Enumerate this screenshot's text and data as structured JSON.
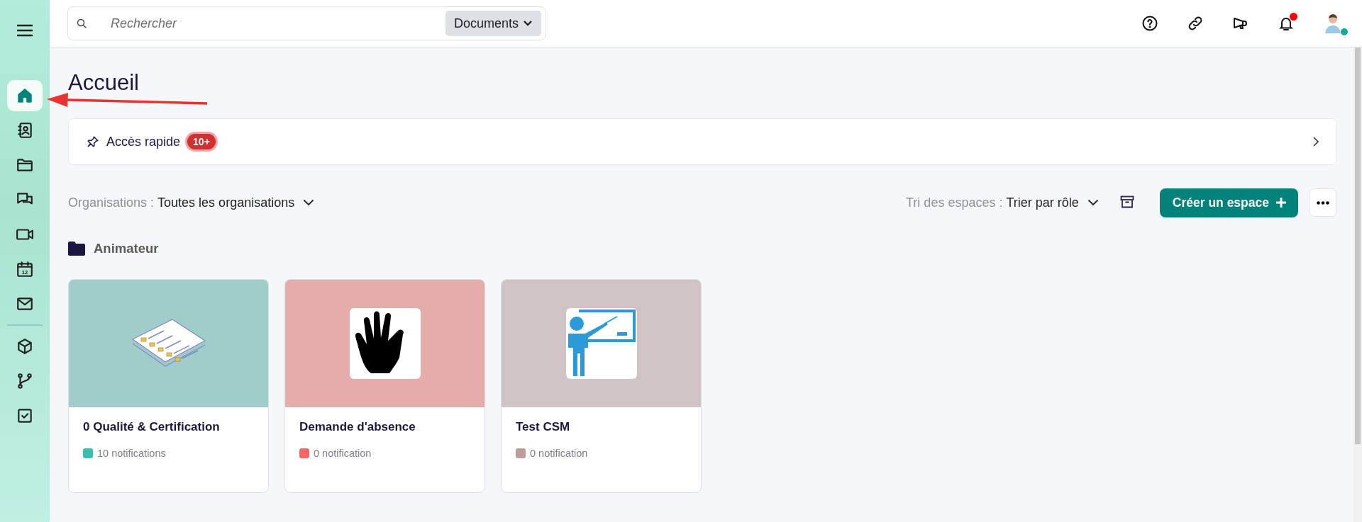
{
  "sidebar": {
    "sections": [
      {
        "items": [
          {
            "selected": true
          },
          {
            "selected": false
          },
          {
            "selected": false
          },
          {
            "selected": false
          },
          {
            "selected": false
          },
          {
            "selected": false,
            "label": "12"
          },
          {
            "selected": false
          }
        ]
      },
      {
        "items": [
          {
            "selected": false
          },
          {
            "selected": false
          },
          {
            "selected": false
          }
        ]
      }
    ]
  },
  "search": {
    "placeholder": "Rechercher",
    "scope": "Documents"
  },
  "topbar": {
    "notifications_unread": true,
    "user_online": true
  },
  "page": {
    "title": "Accueil"
  },
  "quick_access": {
    "label": "Accès rapide",
    "badge": "10+"
  },
  "filters": {
    "organisations_label": "Organisations :",
    "organisations_value": "Toutes les organisations",
    "sort_label": "Tri des espaces :",
    "sort_value": "Trier par rôle",
    "create_button": "Créer un espace"
  },
  "group": {
    "title": "Animateur"
  },
  "spaces": [
    {
      "title": "0 Qualité & Certification",
      "notifications": "10 notifications",
      "color": "#3dbdb0",
      "kind": "checklist"
    },
    {
      "title": "Demande d'absence",
      "notifications": "0 notification",
      "color": "#f86666",
      "kind": "hand"
    },
    {
      "title": "Test CSM",
      "notifications": "0 notification",
      "color": "#bc9c9c",
      "kind": "teacher"
    }
  ],
  "annotation": {
    "arrow": true
  }
}
